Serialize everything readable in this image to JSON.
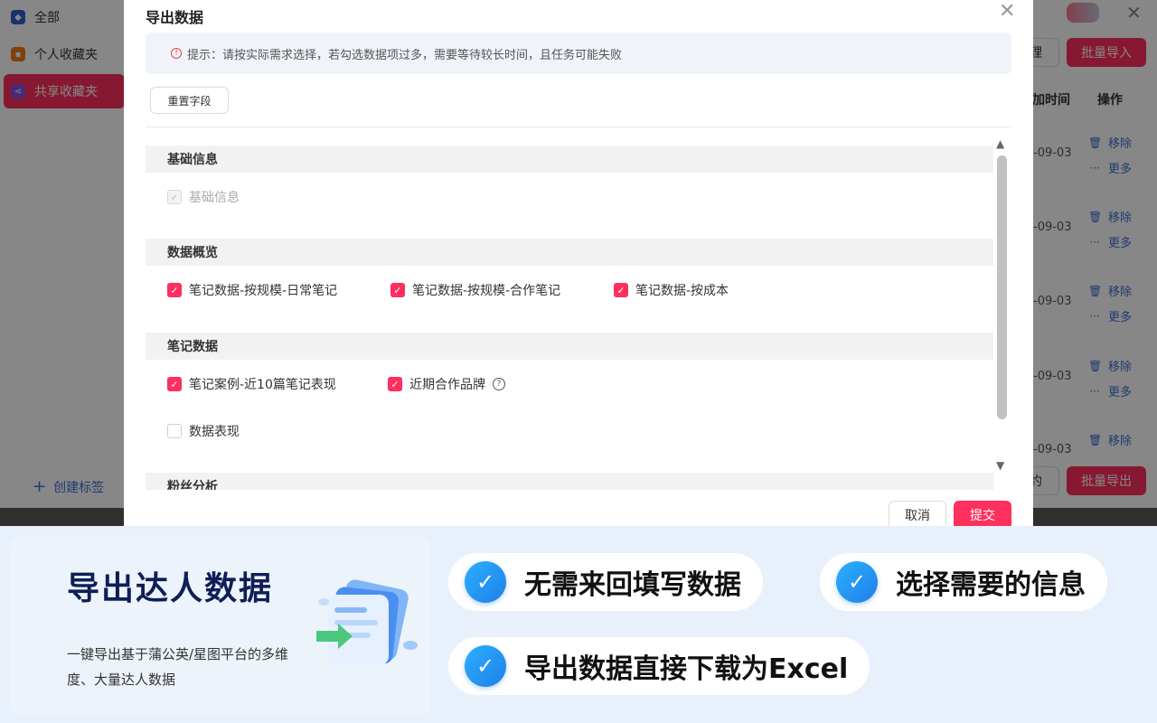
{
  "sidebar": {
    "items": [
      {
        "label": "全部",
        "icon": "tag-icon"
      },
      {
        "label": "个人收藏夹",
        "icon": "folder-icon"
      },
      {
        "label": "共享收藏夹",
        "icon": "share-icon"
      }
    ],
    "create_tag": "创建标签"
  },
  "background": {
    "manage_label": "理",
    "batch_import": "批量导入",
    "batch_export": "批量导出",
    "invite_label": "约",
    "col_added_time": "添加时间",
    "col_actions": "操作",
    "rows": [
      {
        "date": "-09-03",
        "remove": "移除",
        "more": "更多"
      },
      {
        "date": "-09-03",
        "remove": "移除",
        "more": "更多"
      },
      {
        "date": "-09-03",
        "remove": "移除",
        "more": "更多"
      },
      {
        "date": "-09-03",
        "remove": "移除",
        "more": "更多"
      },
      {
        "date": "-09-03",
        "remove": "移除"
      }
    ]
  },
  "modal": {
    "title": "导出数据",
    "notice": "提示：请按实际需求选择，若勾选数据项过多，需要等待较长时间，且任务可能失败",
    "reset_button": "重置字段",
    "sections": [
      {
        "title": "基础信息",
        "options": [
          {
            "label": "基础信息",
            "checked": true,
            "disabled": true
          }
        ]
      },
      {
        "title": "数据概览",
        "options": [
          {
            "label": "笔记数据-按规模-日常笔记",
            "checked": true
          },
          {
            "label": "笔记数据-按规模-合作笔记",
            "checked": true
          },
          {
            "label": "笔记数据-按成本",
            "checked": true
          }
        ]
      },
      {
        "title": "笔记数据",
        "options": [
          {
            "label": "笔记案例-近10篇笔记表现",
            "checked": true
          },
          {
            "label": "近期合作品牌",
            "checked": true,
            "help": true
          },
          {
            "label": "数据表现",
            "checked": false
          }
        ]
      },
      {
        "title": "粉丝分析",
        "options": []
      }
    ],
    "cancel": "取消",
    "submit": "提交"
  },
  "promo": {
    "title": "导出达人数据",
    "desc": "一键导出基于蒲公英/星图平台的多维度、大量达人数据",
    "features": [
      "无需来回填写数据",
      "选择需要的信息",
      "导出数据直接下载为Excel"
    ]
  },
  "colors": {
    "accent": "#ff2f5e",
    "link": "#3b6fd6",
    "promo_title": "#0f1e57"
  }
}
